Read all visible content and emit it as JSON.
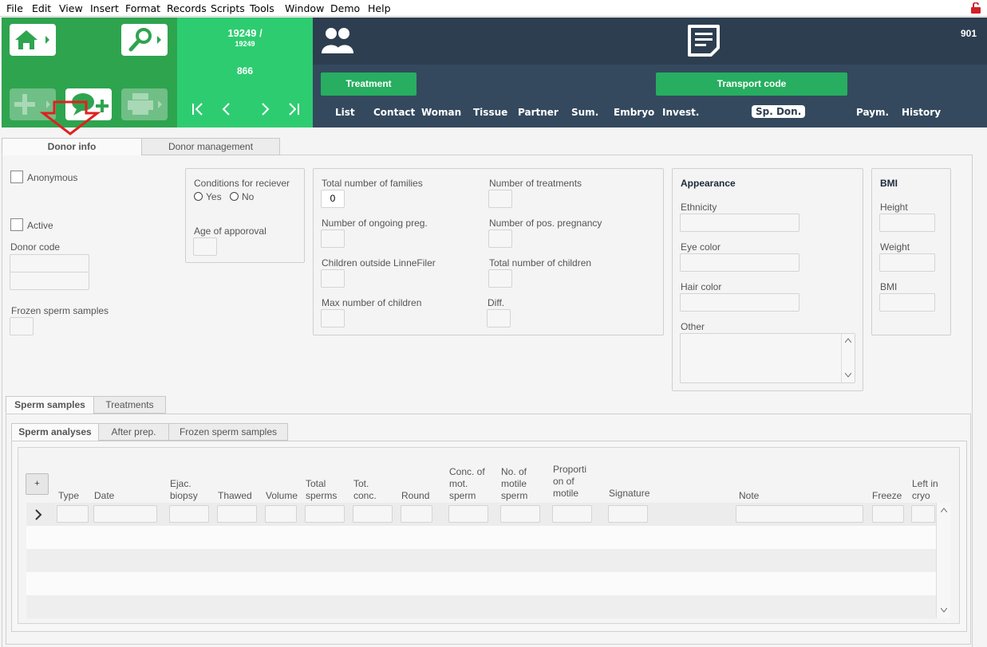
{
  "menu": [
    "File",
    "Edit",
    "View",
    "Insert",
    "Format",
    "Records",
    "Scripts",
    "Tools",
    "Window",
    "Demo",
    "Help"
  ],
  "header": {
    "record_counter": "19249 /",
    "record_total": "19249",
    "record_id": "866",
    "user_number": "901",
    "treatment_button": "Treatment",
    "transport_button": "Transport code",
    "nav_tabs": [
      "List",
      "Contact",
      "Woman",
      "Tissue",
      "Partner",
      "Sum.",
      "Embryo",
      "Invest.",
      "Sp. Don.",
      "Paym.",
      "History"
    ],
    "active_nav_tab": "Sp. Don."
  },
  "main_tabs": [
    "Donor info",
    "Donor management"
  ],
  "donor": {
    "anonymous_label": "Anonymous",
    "active_label": "Active",
    "donor_code_label": "Donor code",
    "frozen_label": "Frozen sperm samples"
  },
  "conditions": {
    "title": "Conditions for reciever",
    "yes": "Yes",
    "no": "No",
    "age_label": "Age of apporoval"
  },
  "stats": {
    "total_families": "Total number of families",
    "total_families_value": "0",
    "num_treatments": "Number of treatments",
    "ongoing_preg": "Number of ongoing preg.",
    "pos_pregnancy": "Number of pos. pregnancy",
    "children_outside": "Children outside LinneFiler",
    "total_children": "Total number of children",
    "max_children": "Max number of children",
    "diff": "Diff."
  },
  "appearance": {
    "title": "Appearance",
    "ethnicity": "Ethnicity",
    "eye_color": "Eye color",
    "hair_color": "Hair color",
    "other": "Other"
  },
  "bmi": {
    "title": "BMI",
    "height": "Height",
    "weight": "Weight",
    "bmi": "BMI"
  },
  "lower_tabs": [
    "Sperm samples",
    "Treatments"
  ],
  "sub_tabs": [
    "Sperm analyses",
    "After prep.",
    "Frozen sperm samples"
  ],
  "table": {
    "add_label": "+",
    "columns": [
      "Type",
      "Date",
      "Ejac. biopsy",
      "Thawed",
      "Volume",
      "Total sperms",
      "Tot. conc.",
      "Round",
      "Conc. of mot. sperm",
      "No. of motile sperm",
      "Proporti on of motile",
      "Signature",
      "Note",
      "Freeze",
      "Left in cryo"
    ]
  },
  "colors": {
    "green_dark": "#2ea44f",
    "green_light": "#2ecc71",
    "navy": "#2d3e50",
    "annotation_arrow": "#e02020"
  }
}
